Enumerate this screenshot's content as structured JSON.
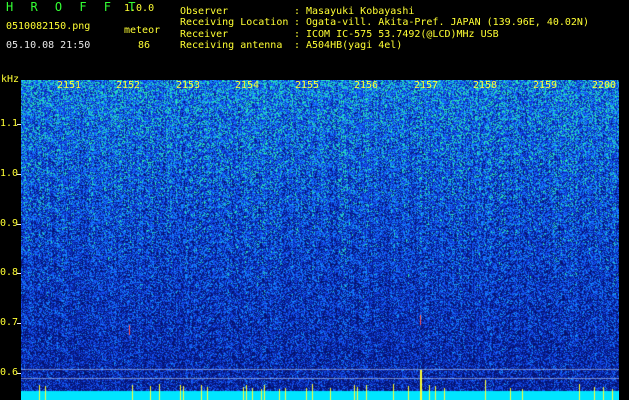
{
  "header": {
    "app_title": "H R O F F T",
    "app_version": "1.0.0",
    "filename": "0510082150.png",
    "mode": "meteor",
    "datetime": "05.10.08 21:50",
    "count": "86"
  },
  "info": [
    {
      "key": "Observer",
      "value": "Masayuki Kobayashi"
    },
    {
      "key": "Receiving Location",
      "value": "Ogata-vill. Akita-Pref. JAPAN (139.96E, 40.02N)"
    },
    {
      "key": "Receiver",
      "value": "ICOM IC-575 53.7492(@LCD)MHz USB"
    },
    {
      "key": "Receiving antenna",
      "value": "A504HB(yagi 4el)"
    }
  ],
  "separator": ":",
  "spectrogram": {
    "y_unit": "kHz",
    "y_ticks": [
      "1.1",
      "1.0",
      "0.9",
      "0.8",
      "0.7",
      "0.6"
    ],
    "x_ticks": [
      "2151",
      "2152",
      "2153",
      "2154",
      "2155",
      "2156",
      "2157",
      "2158",
      "2159",
      "2200"
    ],
    "colors": {
      "low": "#0a1f8f",
      "mid": "#1e5aff",
      "high": "#2ee8c8",
      "peak": "#ffff33",
      "baseline": "#00e5ff"
    }
  }
}
